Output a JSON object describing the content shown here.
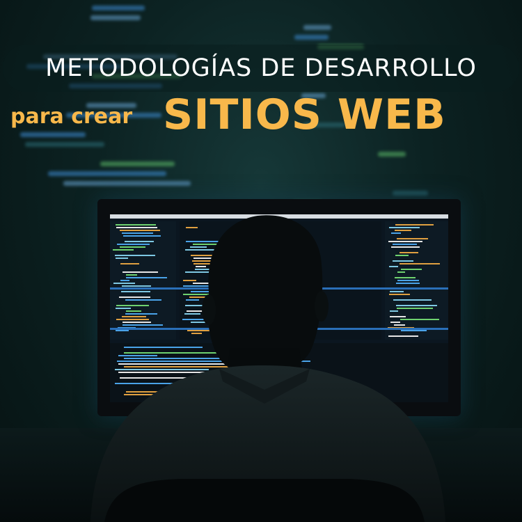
{
  "headline": {
    "line1": "METODOLOGÍAS DE DESARROLLO",
    "prefix": "para crear",
    "main": "SITIOS WEB"
  },
  "colors": {
    "accent": "#f8b84b",
    "headline_text": "#ffffff",
    "background": "#0c2222",
    "code_blue": "#3f8fd9",
    "code_green": "#5fbf6a"
  },
  "scene": {
    "subject": "person-silhouette",
    "device": "monitor"
  }
}
